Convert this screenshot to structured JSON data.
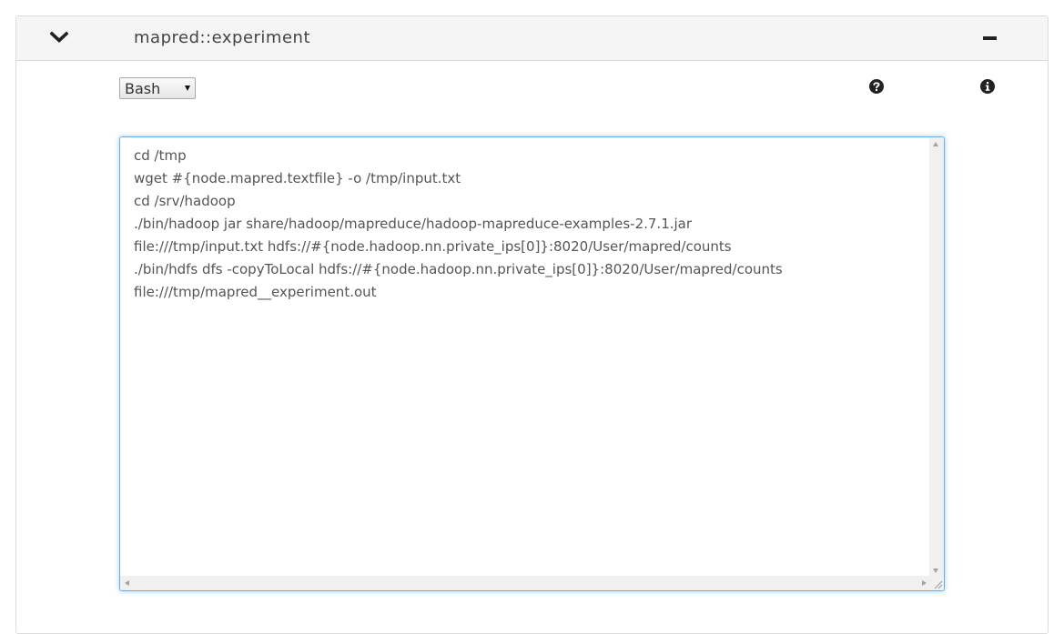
{
  "panel": {
    "title": "mapred::experiment",
    "icons": {
      "collapse": "chevron-down-icon",
      "minimize": "minus-icon",
      "help": "question-circle-icon",
      "info": "info-circle-icon"
    }
  },
  "language_select": {
    "value": "Bash"
  },
  "script": {
    "lines": [
      "cd /tmp",
      "wget #{node.mapred.textfile} -o /tmp/input.txt",
      "cd /srv/hadoop",
      "./bin/hadoop jar share/hadoop/mapreduce/hadoop-mapreduce-examples-2.7.1.jar",
      "file:///tmp/input.txt hdfs://#{node.hadoop.nn.private_ips[0]}:8020/User/mapred/counts",
      "./bin/hdfs dfs -copyToLocal hdfs://#{node.hadoop.nn.private_ips[0]}:8020/User/mapred/counts",
      "file:///tmp/mapred__experiment.out"
    ]
  },
  "colors": {
    "focus_border": "#66afe9",
    "header_bg": "#f5f5f5",
    "text": "#555555"
  }
}
